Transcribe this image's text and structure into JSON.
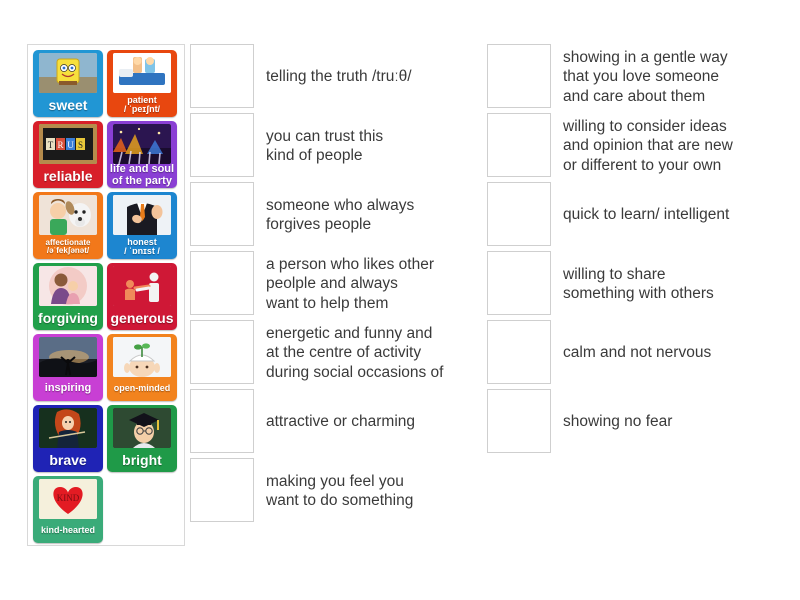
{
  "tiles": [
    {
      "label": "sweet",
      "color": "#2196d4",
      "size": "s1",
      "art": "sponge"
    },
    {
      "label": "patient\n/ ˈpeɪʃnt/",
      "color": "#e8470f",
      "size": "s3",
      "art": "bed"
    },
    {
      "label": "reliable",
      "color": "#d81f2a",
      "size": "s1",
      "art": "trust"
    },
    {
      "label": "life and soul\nof the party",
      "color": "#8a3fd4",
      "size": "s2",
      "art": "party"
    },
    {
      "label": "affectionate\n/əˈfekʃənət/",
      "color": "#f2781a",
      "size": "s4",
      "art": "hug-dog"
    },
    {
      "label": "honest\n/ ˈɒnɪst /",
      "color": "#1d86d0",
      "size": "s3",
      "art": "suit"
    },
    {
      "label": "forgiving",
      "color": "#21a04a",
      "size": "s1",
      "art": "embrace"
    },
    {
      "label": "generous",
      "color": "#cf1836",
      "size": "s1",
      "art": "give"
    },
    {
      "label": "inspiring",
      "color": "#c83fd4",
      "size": "s2",
      "art": "sunrise"
    },
    {
      "label": "open-minded",
      "color": "#f2831e",
      "size": "s3",
      "art": "mind"
    },
    {
      "label": "brave",
      "color": "#1f23b5",
      "size": "s1",
      "art": "merida"
    },
    {
      "label": "bright",
      "color": "#1f9a48",
      "size": "s1",
      "art": "grad"
    },
    {
      "label": "kind-hearted",
      "color": "#3aab79",
      "size": "s3",
      "art": "heart"
    }
  ],
  "middle_column": [
    {
      "text": "telling the truth /truːθ/"
    },
    {
      "text": "you can trust this\nkind of people"
    },
    {
      "text": "someone who always\nforgives people"
    },
    {
      "text": "a person who likes other\npeolple and always\nwant to help them"
    },
    {
      "text": "energetic and funny and\nat the centre of activity\nduring social occasions of"
    },
    {
      "text": "attractive or charming"
    },
    {
      "text": "making you feel you\nwant to do something"
    }
  ],
  "right_column": [
    {
      "text": "showing in a gentle way\nthat you love someone\nand care about them"
    },
    {
      "text": "willing to consider ideas\nand opinion that are new\nor different to your own"
    },
    {
      "text": "quick to learn/ intelligent"
    },
    {
      "text": "willing to share\nsomething with others"
    },
    {
      "text": "calm and not nervous"
    },
    {
      "text": "showing no fear"
    }
  ],
  "colors": {
    "page_background": "#ffffff",
    "panel_border": "#d8d8d8",
    "dropbox_border": "#cfcfcf",
    "text": "#3a3a3a"
  }
}
